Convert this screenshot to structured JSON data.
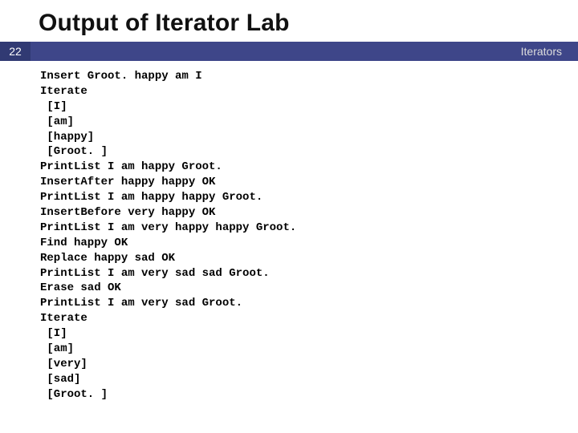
{
  "header": {
    "title": "Output of Iterator Lab",
    "page_number": "22",
    "bar_label": "Iterators"
  },
  "code_block": "Insert Groot. happy am I\nIterate\n [I]\n [am]\n [happy]\n [Groot. ]\nPrintList I am happy Groot.\nInsertAfter happy happy OK\nPrintList I am happy happy Groot.\nInsertBefore very happy OK\nPrintList I am very happy happy Groot.\nFind happy OK\nReplace happy sad OK\nPrintList I am very sad sad Groot.\nErase sad OK\nPrintList I am very sad Groot.\nIterate\n [I]\n [am]\n [very]\n [sad]\n [Groot. ]"
}
